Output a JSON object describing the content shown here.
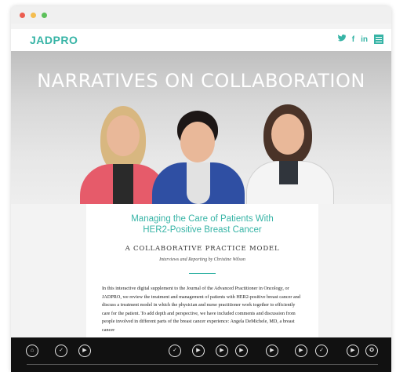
{
  "site": {
    "logo": "JADPRO",
    "social": [
      {
        "icon": "twitter-icon",
        "glyph": "🐦"
      },
      {
        "icon": "facebook-icon",
        "glyph": "f"
      },
      {
        "icon": "linkedin-icon",
        "glyph": "in"
      },
      {
        "icon": "menu-icon",
        "glyph": ""
      }
    ]
  },
  "hero": {
    "title": "NARRATIVES ON COLLABORATION"
  },
  "article": {
    "title_line1": "Managing the Care of Patients With",
    "title_line2": "HER2-Positive Breast Cancer",
    "subtitle": "A COLLABORATIVE PRACTICE MODEL",
    "byline": "Interviews and Reporting by Christine Wilson",
    "body": "In this interactive digital supplement to the Journal of the Advanced Practitioner in Oncology, or JADPRO, we review the treatment and management of patients with HER2-positive breast cancer and discuss a treatment model in which the physician and nurse practitioner work together to efficiently care for the patient. To add depth and perspective, we have included comments and discussion from people involved in different parts of the breast cancer experience: Angela DeMichele, MD, a breast cancer"
  },
  "colors": {
    "accent": "#37b4a6",
    "player_bg": "#111111"
  },
  "player": {
    "buttons": [
      {
        "icon": "home-icon",
        "glyph": "⌂"
      },
      {
        "icon": "check-icon",
        "glyph": "✓"
      },
      {
        "icon": "play-icon",
        "glyph": "▶"
      },
      {
        "icon": "check-icon",
        "glyph": "✓"
      },
      {
        "icon": "play-icon",
        "glyph": "▶"
      },
      {
        "icon": "play-icon",
        "glyph": "▶"
      },
      {
        "icon": "play-icon",
        "glyph": "▶"
      },
      {
        "icon": "play-icon",
        "glyph": "▶"
      },
      {
        "icon": "play-icon",
        "glyph": "▶"
      },
      {
        "icon": "check-icon",
        "glyph": "✓"
      },
      {
        "icon": "play-icon",
        "glyph": "▶"
      },
      {
        "icon": "award-icon",
        "glyph": "✪"
      }
    ]
  }
}
